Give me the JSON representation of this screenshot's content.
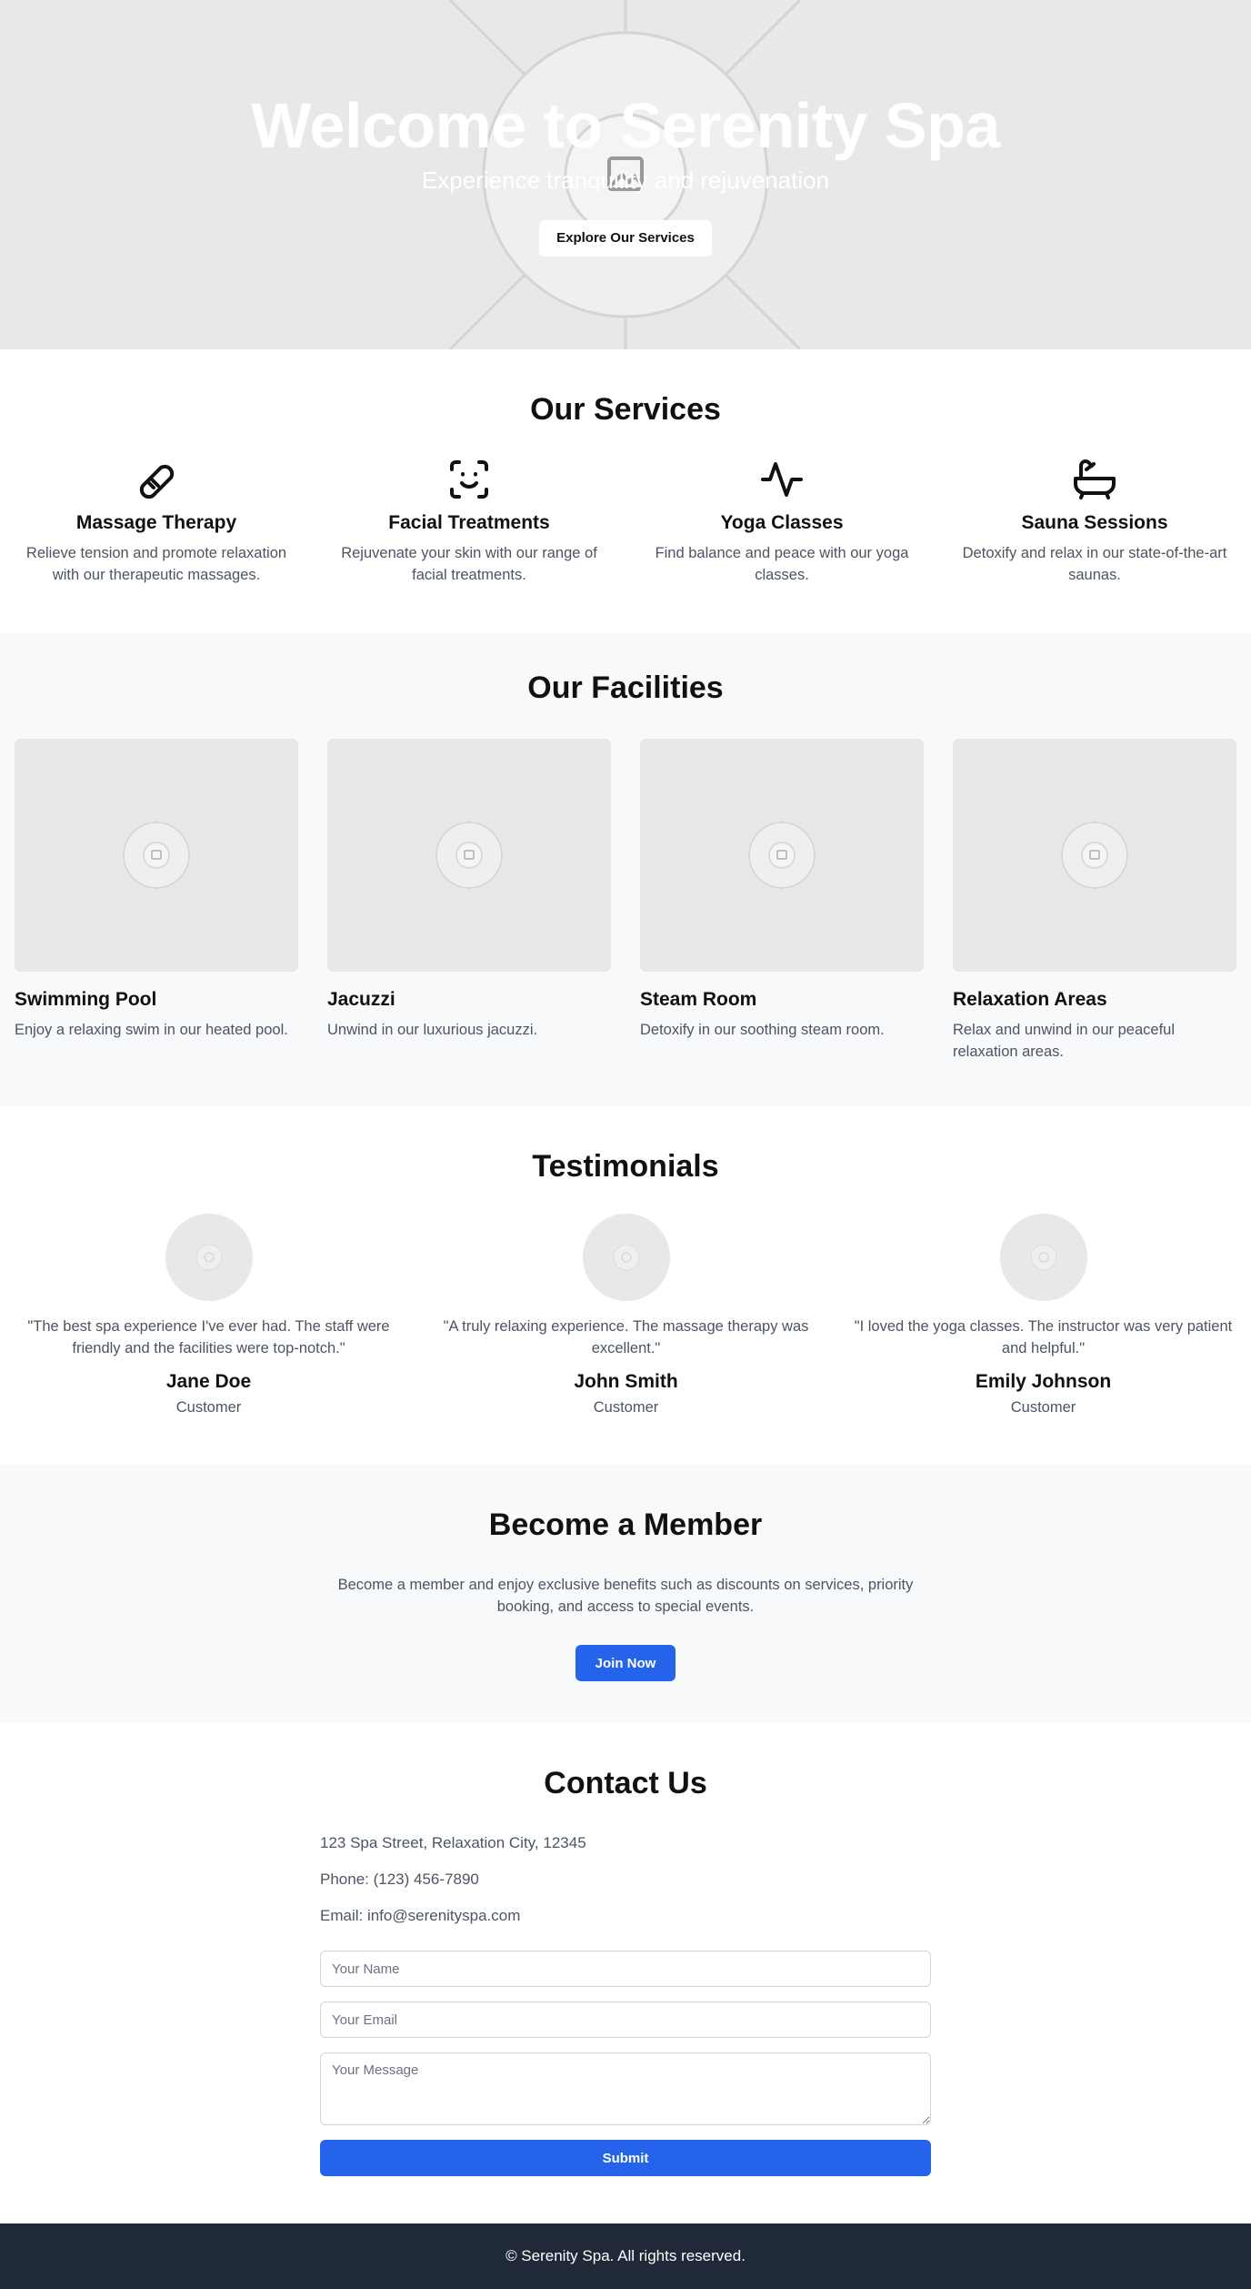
{
  "hero": {
    "title": "Welcome to Serenity Spa",
    "subtitle": "Experience tranquility and rejuvenation",
    "button_label": "Explore Our Services"
  },
  "services": {
    "title": "Our Services",
    "items": [
      {
        "icon": "bandage-icon",
        "title": "Massage Therapy",
        "description": "Relieve tension and promote relaxation with our therapeutic massages."
      },
      {
        "icon": "face-scan-icon",
        "title": "Facial Treatments",
        "description": "Rejuvenate your skin with our range of facial treatments."
      },
      {
        "icon": "activity-pulse-icon",
        "title": "Yoga Classes",
        "description": "Find balance and peace with our yoga classes."
      },
      {
        "icon": "bathtub-icon",
        "title": "Sauna Sessions",
        "description": "Detoxify and relax in our state-of-the-art saunas."
      }
    ]
  },
  "facilities": {
    "title": "Our Facilities",
    "items": [
      {
        "title": "Swimming Pool",
        "description": "Enjoy a relaxing swim in our heated pool."
      },
      {
        "title": "Jacuzzi",
        "description": "Unwind in our luxurious jacuzzi."
      },
      {
        "title": "Steam Room",
        "description": "Detoxify in our soothing steam room."
      },
      {
        "title": "Relaxation Areas",
        "description": "Relax and unwind in our peaceful relaxation areas."
      }
    ]
  },
  "testimonials": {
    "title": "Testimonials",
    "items": [
      {
        "quote": "\"The best spa experience I've ever had. The staff were friendly and the facilities were top-notch.\"",
        "name": "Jane Doe",
        "role": "Customer"
      },
      {
        "quote": "\"A truly relaxing experience. The massage therapy was excellent.\"",
        "name": "John Smith",
        "role": "Customer"
      },
      {
        "quote": "\"I loved the yoga classes. The instructor was very patient and helpful.\"",
        "name": "Emily Johnson",
        "role": "Customer"
      }
    ]
  },
  "membership": {
    "title": "Become a Member",
    "description": "Become a member and enjoy exclusive benefits such as discounts on services, priority booking, and access to special events.",
    "button_label": "Join Now"
  },
  "contact": {
    "title": "Contact Us",
    "address": "123 Spa Street, Relaxation City, 12345",
    "phone": "Phone: (123) 456-7890",
    "email": "Email: info@serenityspa.com",
    "name_placeholder": "Your Name",
    "email_placeholder": "Your Email",
    "message_placeholder": "Your Message",
    "submit_label": "Submit"
  },
  "footer": {
    "text": "© Serenity Spa. All rights reserved."
  },
  "colors": {
    "accent": "#2563eb",
    "footer_bg": "#1f2937",
    "alt_section_bg": "#f8f9fa",
    "placeholder_bg": "#e8e8e8"
  }
}
